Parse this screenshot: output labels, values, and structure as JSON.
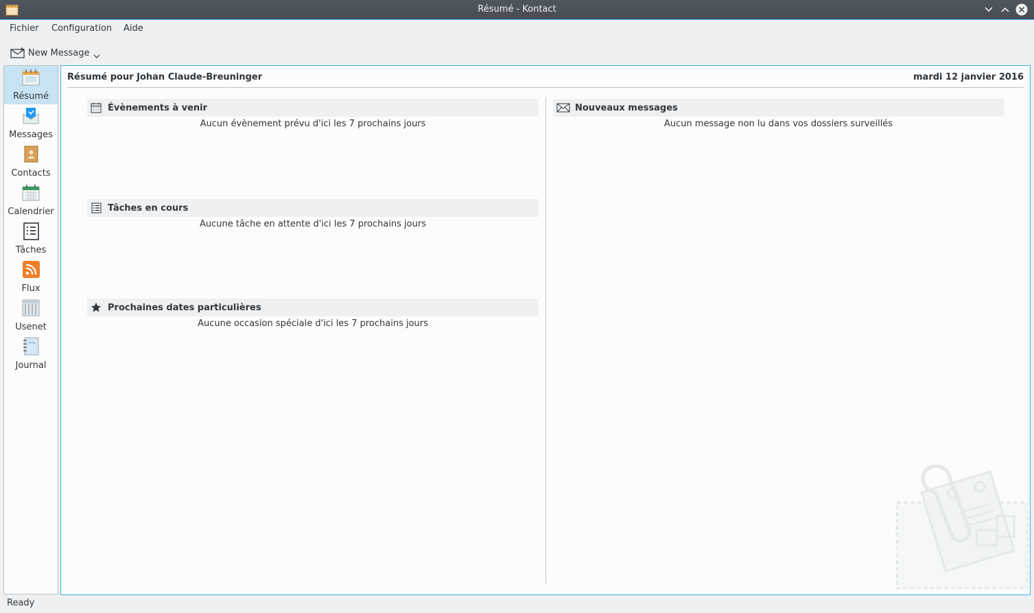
{
  "window": {
    "title": "Résumé - Kontact"
  },
  "menu": [
    "Fichier",
    "Configuration",
    "Aide"
  ],
  "toolbar": {
    "new_message": "New Message"
  },
  "sidebar": {
    "items": [
      {
        "label": "Résumé",
        "icon": "summary-icon",
        "active": true
      },
      {
        "label": "Messages",
        "icon": "mail-icon"
      },
      {
        "label": "Contacts",
        "icon": "contacts-icon"
      },
      {
        "label": "Calendrier",
        "icon": "calendar-icon"
      },
      {
        "label": "Tâches",
        "icon": "tasks-icon"
      },
      {
        "label": "Flux",
        "icon": "rss-feed-icon"
      },
      {
        "label": "Usenet",
        "icon": "usenet-icon"
      },
      {
        "label": "Journal",
        "icon": "journal-icon"
      }
    ]
  },
  "summary": {
    "heading": "Résumé pour Johan Claude-Breuninger",
    "date": "mardi 12 janvier 2016",
    "events": {
      "title": "Évènements à venir",
      "empty": "Aucun évènement prévu d'ici les 7 prochains jours"
    },
    "tasks": {
      "title": "Tâches en cours",
      "empty": "Aucune tâche en attente d'ici les 7 prochains jours"
    },
    "special_dates": {
      "title": "Prochaines dates particulières",
      "empty": "Aucune occasion spéciale d'ici les 7 prochains jours"
    },
    "new_messages": {
      "title": "Nouveaux messages",
      "empty": "Aucun message non lu dans vos dossiers surveillés"
    }
  },
  "status": {
    "text": "Ready"
  },
  "colors": {
    "accent": "#3daee9",
    "titlebar": "#4d5358",
    "selection": "#c8e3f3",
    "rss": "#f07f2c"
  }
}
